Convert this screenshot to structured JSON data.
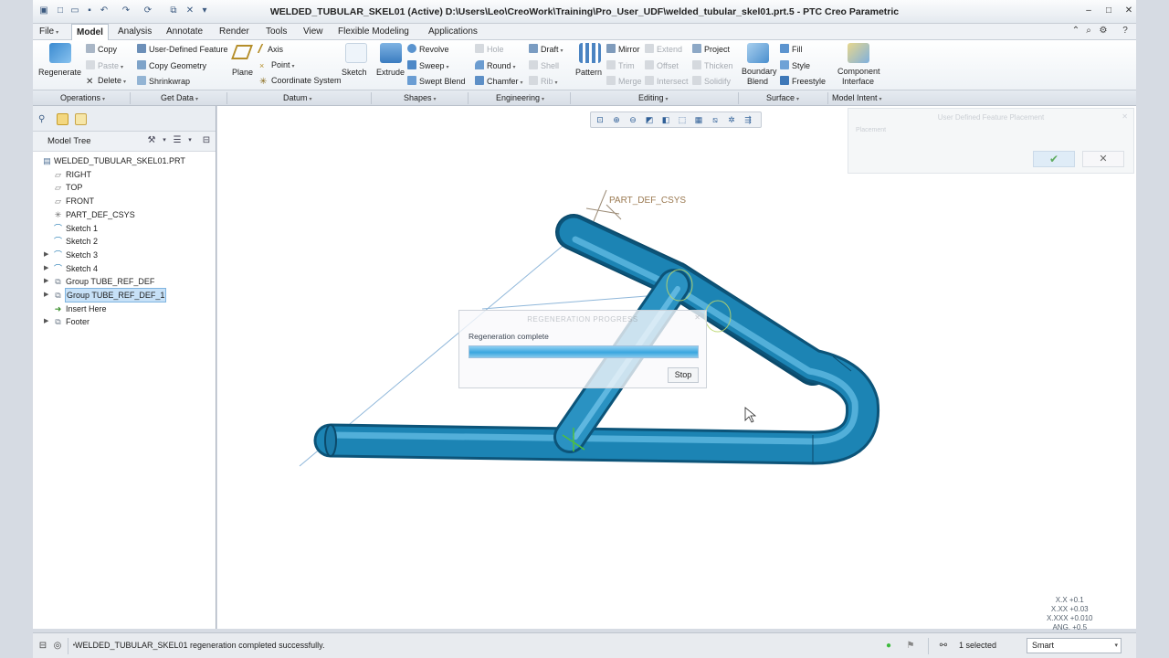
{
  "window": {
    "title": "WELDED_TUBULAR_SKEL01 (Active) D:\\Users\\Leo\\CreoWork\\Training\\Pro_User_UDF\\welded_tubular_skel01.prt.5 - PTC Creo Parametric"
  },
  "menu": {
    "file": "File",
    "tabs": [
      "Model",
      "Analysis",
      "Annotate",
      "Render",
      "Tools",
      "View",
      "Flexible Modeling",
      "Applications"
    ],
    "active_tab": "Model"
  },
  "ribbon": {
    "regenerate": "Regenerate",
    "copy": "Copy",
    "paste": "Paste",
    "delete": "Delete",
    "user_defined_feature": "User-Defined Feature",
    "copy_geometry": "Copy Geometry",
    "shrinkwrap": "Shrinkwrap",
    "plane": "Plane",
    "axis": "Axis",
    "point": "Point",
    "coordinate_system": "Coordinate System",
    "sketch": "Sketch",
    "extrude": "Extrude",
    "revolve": "Revolve",
    "sweep": "Sweep",
    "swept_blend": "Swept Blend",
    "hole": "Hole",
    "round": "Round",
    "chamfer": "Chamfer",
    "draft": "Draft",
    "shell": "Shell",
    "rib": "Rib",
    "pattern": "Pattern",
    "mirror": "Mirror",
    "trim": "Trim",
    "merge": "Merge",
    "extend": "Extend",
    "offset": "Offset",
    "intersect": "Intersect",
    "project": "Project",
    "thicken": "Thicken",
    "solidify": "Solidify",
    "boundary_blend_1": "Boundary",
    "boundary_blend_2": "Blend",
    "fill": "Fill",
    "style": "Style",
    "freestyle": "Freestyle",
    "component_interface_1": "Component",
    "component_interface_2": "Interface"
  },
  "groups": [
    "Operations",
    "Get Data",
    "Datum",
    "Shapes",
    "Engineering",
    "Editing",
    "Surface",
    "Model Intent"
  ],
  "model_tree": {
    "header": "Model Tree",
    "items": [
      {
        "label": "WELDED_TUBULAR_SKEL01.PRT",
        "icon": "part-icon"
      },
      {
        "label": "RIGHT",
        "icon": "datum-plane-icon"
      },
      {
        "label": "TOP",
        "icon": "datum-plane-icon"
      },
      {
        "label": "FRONT",
        "icon": "datum-plane-icon"
      },
      {
        "label": "PART_DEF_CSYS",
        "icon": "csys-icon"
      },
      {
        "label": "Sketch 1",
        "icon": "sketch-icon"
      },
      {
        "label": "Sketch 2",
        "icon": "sketch-icon"
      },
      {
        "label": "Sketch 3",
        "icon": "sketch-icon"
      },
      {
        "label": "Sketch 4",
        "icon": "sketch-icon"
      },
      {
        "label": "Group TUBE_REF_DEF",
        "icon": "group-icon"
      },
      {
        "label": "Group TUBE_REF_DEF_1",
        "icon": "group-icon"
      },
      {
        "label": "Insert Here",
        "icon": "insert-arrow-icon"
      },
      {
        "label": "Footer",
        "icon": "footer-icon"
      }
    ]
  },
  "udf_dialog": {
    "title": "User Defined Feature Placement",
    "tab": "Placement"
  },
  "regen_dialog": {
    "title": "REGENERATION PROGRESS",
    "message": "Regeneration complete",
    "progress": 1.0,
    "stop": "Stop"
  },
  "viewport": {
    "csys_label": "PART_DEF_CSYS",
    "tube_color": "#1f86b6"
  },
  "tolerance": {
    "l1": "X.X +0.1",
    "l2": "X.XX +0.03",
    "l3": "X.XXX +0.010",
    "l4": "ANG. +0.5"
  },
  "status": {
    "message": "WELDED_TUBULAR_SKEL01 regeneration completed successfully.",
    "selected": "1 selected",
    "filter": "Smart"
  }
}
